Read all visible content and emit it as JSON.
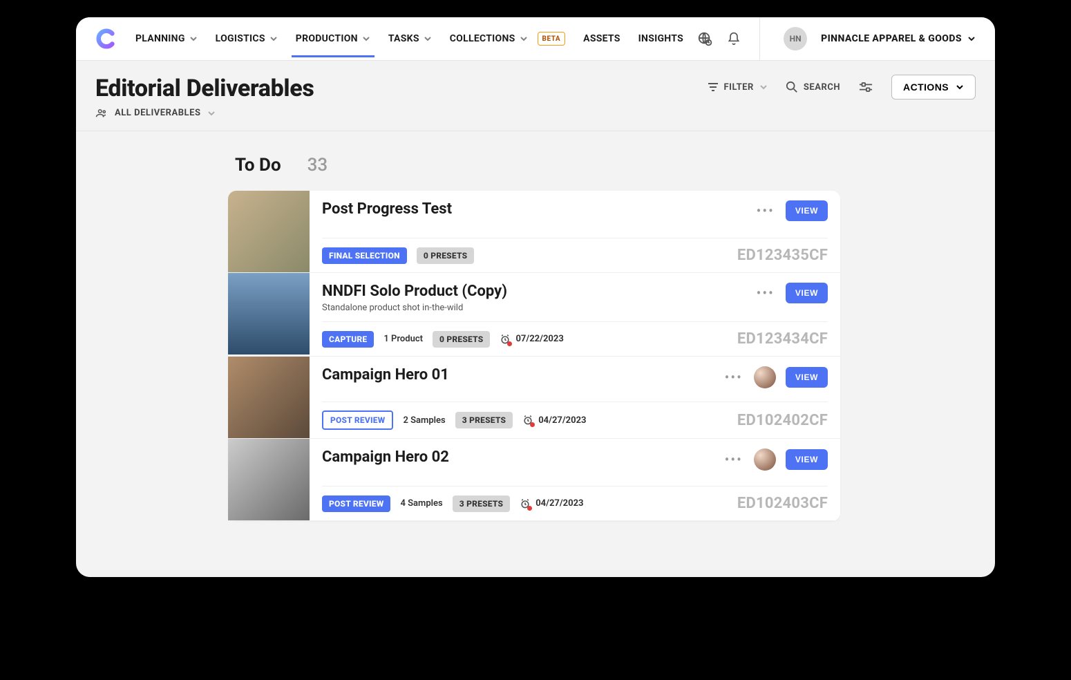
{
  "nav": {
    "items": [
      {
        "label": "PLANNING",
        "dropdown": true
      },
      {
        "label": "LOGISTICS",
        "dropdown": true
      },
      {
        "label": "PRODUCTION",
        "dropdown": true,
        "active": true
      },
      {
        "label": "TASKS",
        "dropdown": true
      },
      {
        "label": "COLLECTIONS",
        "dropdown": true,
        "badge": "BETA"
      },
      {
        "label": "ASSETS",
        "dropdown": false
      },
      {
        "label": "INSIGHTS",
        "dropdown": false
      }
    ]
  },
  "user": {
    "initials": "HN",
    "org": "PINNACLE APPAREL & GOODS"
  },
  "page": {
    "title": "Editorial Deliverables",
    "scope": "ALL DELIVERABLES"
  },
  "toolbar": {
    "filter": "FILTER",
    "search": "SEARCH",
    "actions": "ACTIONS"
  },
  "column": {
    "title": "To Do",
    "count": "33",
    "view_label": "VIEW"
  },
  "cards": [
    {
      "title": "Post Progress Test",
      "subtitle": "",
      "status": {
        "text": "FINAL SELECTION",
        "style": "blue-solid"
      },
      "presets": "0 PRESETS",
      "samples": "",
      "due": "",
      "id": "ED123435CF",
      "has_avatar": false
    },
    {
      "title": "NNDFI Solo Product (Copy)",
      "subtitle": "Standalone product shot in-the-wild",
      "status": {
        "text": "CAPTURE",
        "style": "blue-solid"
      },
      "presets": "0 PRESETS",
      "samples": "1 Product",
      "due": "07/22/2023",
      "id": "ED123434CF",
      "has_avatar": false
    },
    {
      "title": "Campaign Hero 01",
      "subtitle": "",
      "status": {
        "text": "POST REVIEW",
        "style": "blue-outline"
      },
      "presets": "3 PRESETS",
      "samples": "2 Samples",
      "due": "04/27/2023",
      "id": "ED102402CF",
      "has_avatar": true
    },
    {
      "title": "Campaign Hero 02",
      "subtitle": "",
      "status": {
        "text": "POST REVIEW",
        "style": "blue-solid"
      },
      "presets": "3 PRESETS",
      "samples": "4 Samples",
      "due": "04/27/2023",
      "id": "ED102403CF",
      "has_avatar": true
    }
  ]
}
